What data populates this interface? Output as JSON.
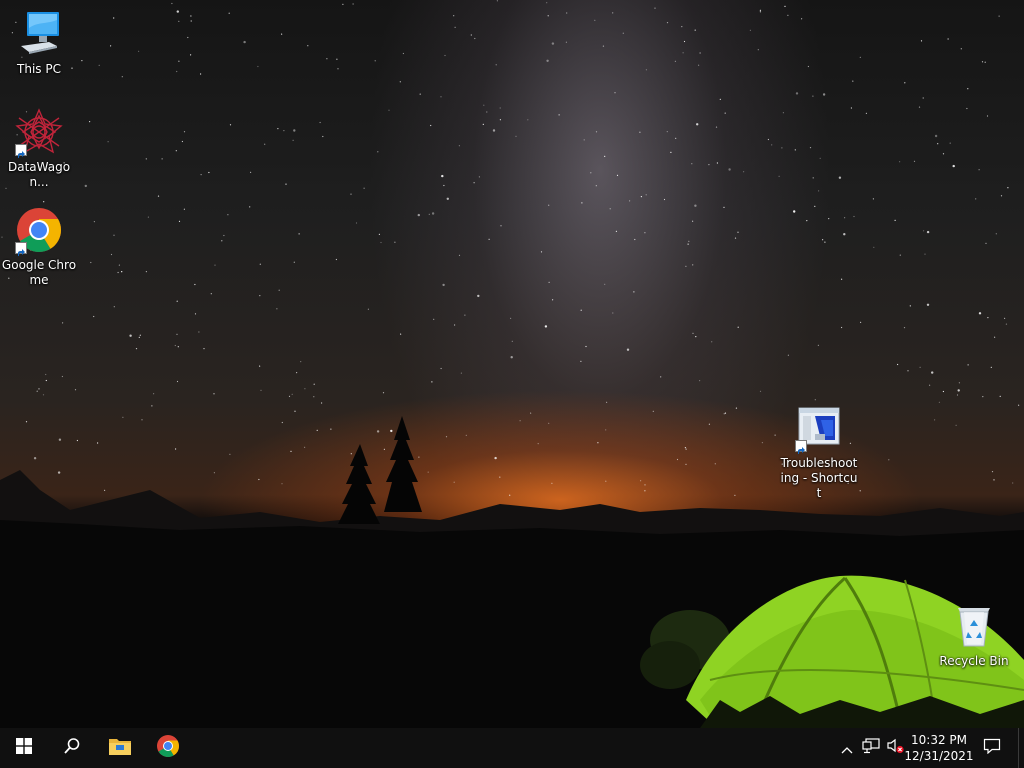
{
  "desktop": {
    "icons": [
      {
        "label": "This PC"
      },
      {
        "label": "DataWagon..."
      },
      {
        "label": "Google Chrome"
      },
      {
        "label": "Troubleshooting - Shortcut"
      },
      {
        "label": "Recycle Bin"
      }
    ]
  },
  "taskbar": {
    "buttons": [
      "windows-start-icon",
      "search-icon",
      "file-explorer-icon",
      "google-chrome-icon"
    ],
    "tray": [
      "chevron-up-icon",
      "network-icon",
      "volume-muted-icon",
      "notifications-icon"
    ],
    "clock": {
      "time": "10:32 PM",
      "date": "12/31/2021"
    }
  },
  "colors": {
    "taskbar": "#101010",
    "accent_windows": "#ffffff",
    "tent_green": "#8fd323",
    "horizon_orange": "#e66e1e"
  }
}
